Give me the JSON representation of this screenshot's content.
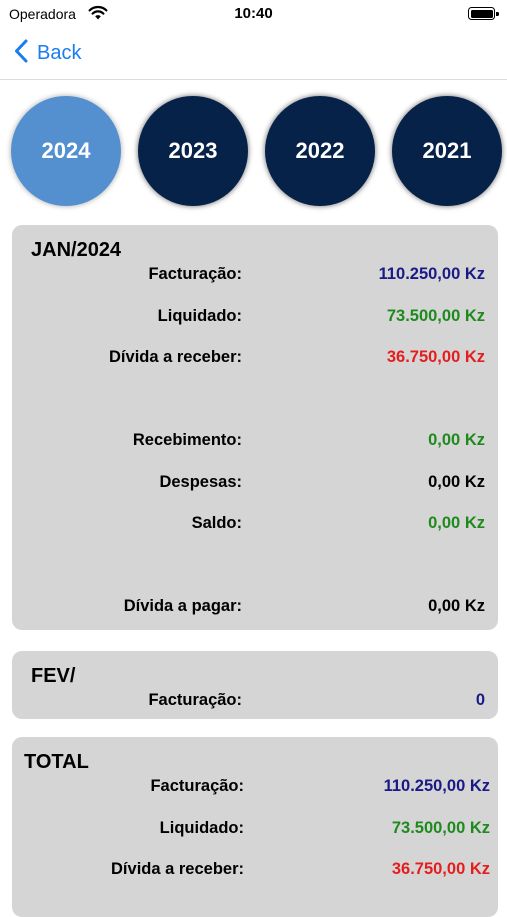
{
  "status_bar": {
    "carrier": "Operadora",
    "time": "10:40"
  },
  "nav": {
    "back_label": "Back"
  },
  "years": [
    "2024",
    "2023",
    "2022",
    "2021"
  ],
  "active_year": "2024",
  "months": [
    {
      "title": "JAN/2024",
      "facturacao_label": "Facturação:",
      "facturacao": "110.250,00 Kz",
      "liquidado_label": "Liquidado:",
      "liquidado": "73.500,00 Kz",
      "divida_receber_label": "Dívida a receber:",
      "divida_receber": "36.750,00 Kz",
      "recebimento_label": "Recebimento:",
      "recebimento": "0,00 Kz",
      "despesas_label": "Despesas:",
      "despesas": "0,00 Kz",
      "saldo_label": "Saldo:",
      "saldo": "0,00 Kz",
      "divida_pagar_label": "Dívida a pagar:",
      "divida_pagar": "0,00 Kz"
    },
    {
      "title": "FEV/",
      "facturacao_label": "Facturação:",
      "facturacao": "0"
    }
  ],
  "total": {
    "title": "TOTAL",
    "facturacao_label": "Facturação:",
    "facturacao": "110.250,00 Kz",
    "liquidado_label": "Liquidado:",
    "liquidado": "73.500,00 Kz",
    "divida_receber_label": "Dívida a receber:",
    "divida_receber": "36.750,00 Kz"
  },
  "colors": {
    "accent": "#1b7cf0",
    "year_active": "#5490d0",
    "year_inactive": "#062249",
    "card": "#d5d5d5",
    "billing": "#1a1a86",
    "positive": "#1e8a1e",
    "negative": "#e41e1e"
  }
}
